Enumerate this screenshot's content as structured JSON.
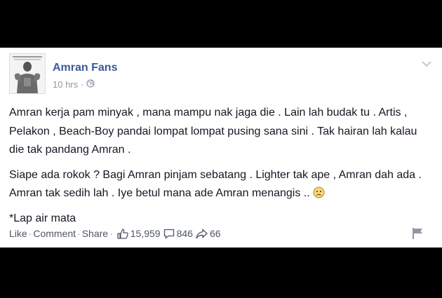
{
  "post": {
    "page_name": "Amran Fans",
    "timestamp": "10 hrs",
    "paragraphs": [
      "Amran kerja pam minyak , mana mampu nak jaga die . Lain lah budak tu . Artis , Pelakon , Beach-Boy pandai lompat lompat pusing sana sini . Tak hairan lah kalau die tak pandang Amran .",
      "Siape ada rokok ? Bagi Amran pinjam sebatang . Lighter tak ape , Amran dah ada . Amran tak sedih lah . Iye betul mana ade Amran menangis ..",
      "*Lap air mata"
    ]
  },
  "actions": {
    "like": "Like",
    "comment": "Comment",
    "share": "Share",
    "likes_count": "15,959",
    "comments_count": "846",
    "shares_count": "66"
  },
  "icons": {
    "privacy": "globe-icon",
    "menu": "chevron-down-icon",
    "likes": "thumbs-up-icon",
    "comments": "comment-bubble-icon",
    "shares": "share-arrow-icon",
    "report": "flag-icon",
    "emoticon": "frown-emoticon-icon"
  },
  "colors": {
    "brand_link": "#3b5998",
    "meta_gray": "#9197a3",
    "body_text": "#141823",
    "action_text": "#4e5665"
  }
}
